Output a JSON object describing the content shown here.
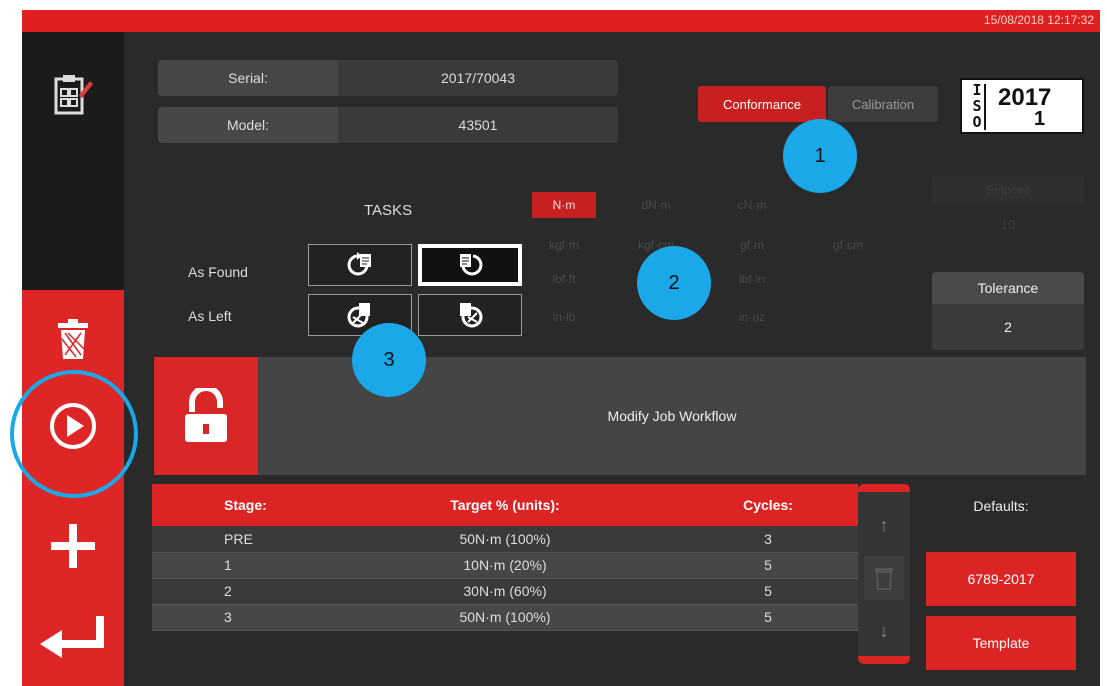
{
  "app": {
    "datetime": "15/08/2018 12:17:32"
  },
  "device": {
    "serial_label": "Serial:",
    "serial_value": "2017/70043",
    "model_label": "Model:",
    "model_value": "43501"
  },
  "mode_tabs": [
    {
      "label": "Conformance",
      "active": true
    },
    {
      "label": "Calibration",
      "active": false
    }
  ],
  "iso_badge": {
    "prefix": "ISO",
    "year": "2017",
    "part": "1"
  },
  "tasks": {
    "title": "TASKS",
    "as_found_label": "As Found",
    "as_left_label": "As Left"
  },
  "units": {
    "row1": [
      "N·m",
      "dN·m",
      "cN·m"
    ],
    "row2": [
      "kgf·m",
      "kgf·cm",
      "gf·m",
      "gf·cm"
    ],
    "row3": [
      "lbf·ft",
      "",
      "lbf·in"
    ],
    "row4": [
      "in·lb",
      "",
      "in·oz"
    ],
    "selected": "N·m"
  },
  "setpoint": {
    "label": "Setpoint",
    "value": "10"
  },
  "tolerance": {
    "label": "Tolerance",
    "value": "2"
  },
  "workflow": {
    "label": "Modify Job Workflow"
  },
  "stages_table": {
    "headers": [
      "Stage:",
      "Target % (units):",
      "Cycles:"
    ],
    "rows": [
      [
        "PRE",
        "50N·m (100%)",
        "3"
      ],
      [
        "1",
        "10N·m (20%)",
        "5"
      ],
      [
        "2",
        "30N·m (60%)",
        "5"
      ],
      [
        "3",
        "50N·m (100%)",
        "5"
      ]
    ]
  },
  "defaults": {
    "label": "Defaults:",
    "preset_button": "6789-2017",
    "template_button": "Template"
  },
  "callouts": [
    "1",
    "2",
    "3"
  ],
  "colors": {
    "accent_red": "#df2626",
    "callout_blue": "#1aa8e8",
    "background": "#2a2a2a"
  }
}
